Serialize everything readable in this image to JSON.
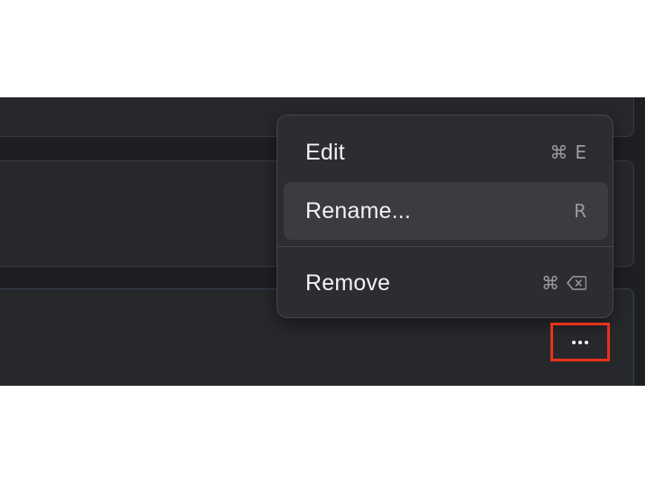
{
  "context_menu": {
    "items": [
      {
        "label": "Edit",
        "shortcut_symbol": "⌘",
        "shortcut_key": "E",
        "highlighted": false
      },
      {
        "label": "Rename...",
        "shortcut_symbol": "",
        "shortcut_key": "R",
        "highlighted": true
      },
      {
        "label": "Remove",
        "shortcut_symbol": "⌘",
        "shortcut_key_icon": "delete-backward-icon",
        "highlighted": false
      }
    ]
  },
  "more_button": {
    "icon": "more-horizontal-icon",
    "highlight_color": "#e8311a"
  },
  "colors": {
    "background": "#1e1f22",
    "card": "#27282c",
    "menu": "#2c2d31",
    "menu_highlight": "#3b3c41",
    "text": "#f2f2f4",
    "shortcut_text": "#9a9ba2"
  }
}
